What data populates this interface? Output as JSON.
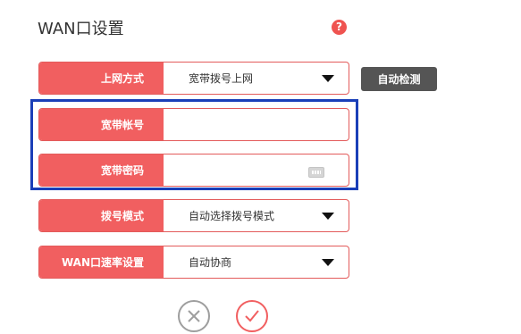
{
  "page": {
    "title": "WAN口设置",
    "help_icon_glyph": "?"
  },
  "form": {
    "rows": [
      {
        "label": "上网方式",
        "value": "宽带拨号上网",
        "control": "select"
      },
      {
        "label": "宽带帐号",
        "value": "",
        "control": "text"
      },
      {
        "label": "宽带密码",
        "value": "",
        "control": "password"
      },
      {
        "label": "拨号模式",
        "value": "自动选择拨号模式",
        "control": "select"
      },
      {
        "label": "WAN口速率设置",
        "value": "自动协商",
        "control": "select"
      }
    ],
    "detect_button_label": "自动检测"
  },
  "colors": {
    "label_bg": "#f15f60",
    "highlight_border": "#1a3fb8",
    "detect_button_bg": "#555555"
  },
  "icons": [
    "help-icon",
    "dropdown-arrow-icon",
    "keyboard-icon",
    "cancel-icon",
    "confirm-icon"
  ]
}
